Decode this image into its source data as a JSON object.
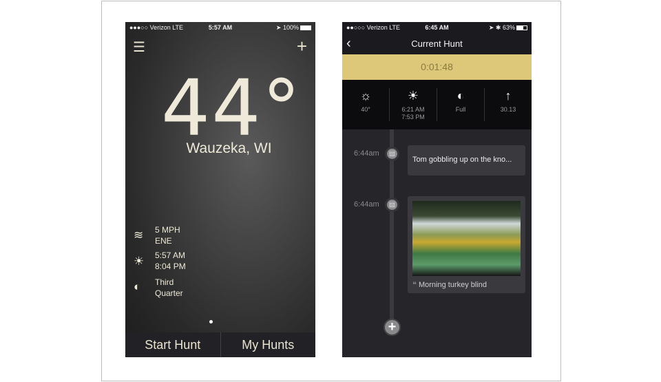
{
  "left": {
    "status": {
      "carrier": "●●●○○ Verizon  LTE",
      "time": "5:57 AM",
      "battery": "100%",
      "battery_level": 1.0
    },
    "temperature": "44°",
    "location": "Wauzeka, WI",
    "wind": {
      "speed": "5 MPH",
      "direction": "ENE"
    },
    "sun": {
      "rise": "5:57 AM",
      "set": "8:04 PM"
    },
    "moon": {
      "line1": "Third",
      "line2": "Quarter"
    },
    "buttons": {
      "start": "Start Hunt",
      "my_hunts": "My Hunts"
    }
  },
  "right": {
    "status": {
      "carrier": "●●○○○ Verizon  LTE",
      "time": "6:45 AM",
      "battery": "63%",
      "battery_level": 0.63
    },
    "title": "Current Hunt",
    "timer": "0:01:48",
    "conditions": [
      {
        "icon": "sun-icon",
        "value": "40°"
      },
      {
        "icon": "sunrise-icon",
        "value": "6:21 AM",
        "value2": "7:53 PM"
      },
      {
        "icon": "moon-icon",
        "value": "Full"
      },
      {
        "icon": "pressure-arrow-icon",
        "value": "30.13"
      }
    ],
    "entries": [
      {
        "time": "6:44am",
        "text": "Tom gobbling up on the kno..."
      },
      {
        "time": "6:44am",
        "caption": "Morning turkey blind"
      }
    ]
  }
}
